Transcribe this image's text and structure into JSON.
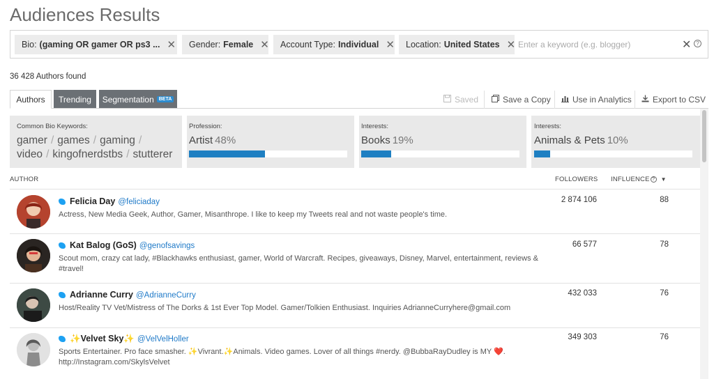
{
  "page": {
    "title": "Audiences Results"
  },
  "filters": {
    "chips": [
      {
        "label": "Bio:",
        "value": "(gaming OR gamer OR ps3 ..."
      },
      {
        "label": "Gender:",
        "value": "Female"
      },
      {
        "label": "Account Type:",
        "value": "Individual"
      },
      {
        "label": "Location:",
        "value": "United States"
      }
    ],
    "remove_glyph": "✕",
    "keyword_placeholder": "Enter a keyword (e.g. blogger)",
    "clear_glyph": "✕",
    "help_glyph": "?"
  },
  "results": {
    "found_text": "36 428 Authors found"
  },
  "tabs": [
    {
      "label": "Authors",
      "active": true
    },
    {
      "label": "Trending",
      "active": false
    },
    {
      "label": "Segmentation",
      "badge": "BETA",
      "active": false
    }
  ],
  "actions": {
    "saved": "Saved",
    "save_copy": "Save a Copy",
    "use_analytics": "Use in Analytics",
    "export_csv": "Export to CSV"
  },
  "summary": {
    "keywords_label": "Common Bio Keywords:",
    "keywords": [
      "gamer",
      "games",
      "gaming",
      "video",
      "kingofnerdstbs",
      "stutterer"
    ],
    "separator": "/",
    "stats": [
      {
        "label": "Profession:",
        "name": "Artist",
        "percent_text": "48%",
        "percent": 48
      },
      {
        "label": "Interests:",
        "name": "Books",
        "percent_text": "19%",
        "percent": 19
      },
      {
        "label": "Interests:",
        "name": "Animals & Pets",
        "percent_text": "10%",
        "percent": 10
      }
    ]
  },
  "table": {
    "headers": {
      "author": "AUTHOR",
      "followers": "FOLLOWERS",
      "influence": "INFLUENCE"
    },
    "help_glyph": "?",
    "sort_glyph": "▼",
    "rows": [
      {
        "name": "Felicia Day",
        "handle": "@feliciaday",
        "bio": "Actress, New Media Geek, Author, Gamer, Misanthrope. I like to keep my Tweets real and not waste people's time.",
        "followers": "2 874 106",
        "influence": "88"
      },
      {
        "name": "Kat Balog (GoS)",
        "handle": "@genofsavings",
        "bio": "Scout mom, crazy cat lady, #Blackhawks enthusiast, gamer, World of Warcraft. Recipes, giveaways, Disney, Marvel, entertainment, reviews & #travel!",
        "followers": "66 577",
        "influence": "78"
      },
      {
        "name": "Adrianne Curry",
        "handle": "@AdrianneCurry",
        "bio": "Host/Reality TV Vet/Mistress of The Dorks & 1st Ever Top Model. Gamer/Tolkien Enthusiast. Inquiries AdrianneCurryhere@gmail.com",
        "followers": "432 033",
        "influence": "76"
      },
      {
        "name": "✨Velvet Sky✨",
        "handle": "@VelVelHoller",
        "bio": "Sports Entertainer. Pro face smasher. ✨Vivrant.✨Animals. Video games. Lover of all things #nerdy. @BubbaRayDudley is MY ❤️. http://Instagram.com/SkylsVelvet",
        "followers": "349 303",
        "influence": "76"
      }
    ]
  },
  "colors": {
    "accent": "#1e7fc2",
    "tab_inactive": "#6b7075",
    "link": "#1f7ac8",
    "twitter": "#1da1f2"
  }
}
